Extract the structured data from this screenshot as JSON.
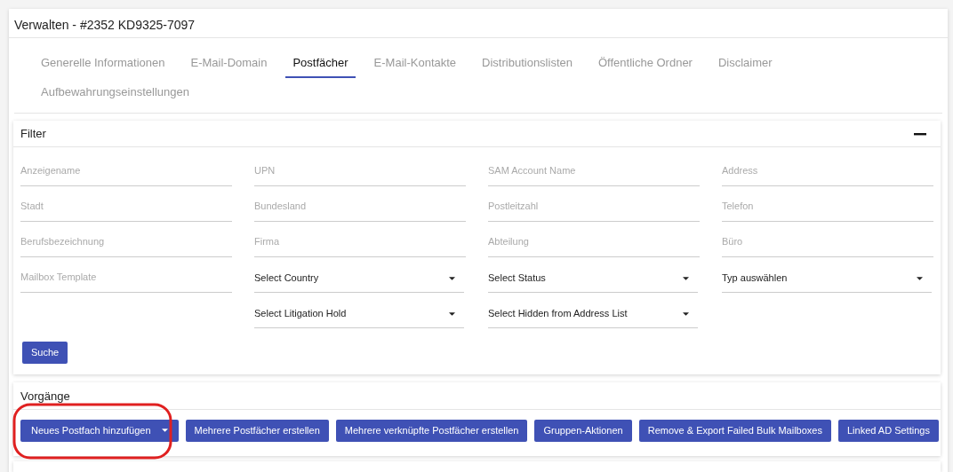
{
  "title": "Verwalten - #2352 KD9325-7097",
  "tabs": [
    {
      "label": "Generelle Informationen",
      "selected": false
    },
    {
      "label": "E-Mail-Domain",
      "selected": false
    },
    {
      "label": "Postfächer",
      "selected": true
    },
    {
      "label": "E-Mail-Kontakte",
      "selected": false
    },
    {
      "label": "Distributionslisten",
      "selected": false
    },
    {
      "label": "Öffentliche Ordner",
      "selected": false
    },
    {
      "label": "Disclaimer",
      "selected": false
    },
    {
      "label": "Aufbewahrungseinstellungen",
      "selected": false
    }
  ],
  "filter": {
    "title": "Filter",
    "expanded": true,
    "rows": [
      [
        {
          "kind": "input",
          "placeholder": "Anzeigename"
        },
        {
          "kind": "input",
          "placeholder": "UPN"
        },
        {
          "kind": "input",
          "placeholder": "SAM Account Name"
        },
        {
          "kind": "input",
          "placeholder": "Address"
        }
      ],
      [
        {
          "kind": "input",
          "placeholder": "Stadt"
        },
        {
          "kind": "input",
          "placeholder": "Bundesland"
        },
        {
          "kind": "input",
          "placeholder": "Postleitzahl"
        },
        {
          "kind": "input",
          "placeholder": "Telefon"
        }
      ],
      [
        {
          "kind": "input",
          "placeholder": "Berufsbezeichnung"
        },
        {
          "kind": "input",
          "placeholder": "Firma"
        },
        {
          "kind": "input",
          "placeholder": "Abteilung"
        },
        {
          "kind": "input",
          "placeholder": "Büro"
        }
      ],
      [
        {
          "kind": "input",
          "placeholder": "Mailbox Template"
        },
        {
          "kind": "select",
          "value": "Select Country"
        },
        {
          "kind": "select",
          "value": "Select Status"
        },
        {
          "kind": "select",
          "value": "Typ auswählen"
        }
      ],
      [
        {
          "kind": "blank"
        },
        {
          "kind": "select",
          "value": "Select Litigation Hold"
        },
        {
          "kind": "select",
          "value": "Select Hidden from Address List"
        },
        {
          "kind": "blank"
        }
      ]
    ],
    "search_button": "Suche"
  },
  "actions": {
    "title": "Vorgänge",
    "buttons": [
      {
        "label": "Neues Postfach hinzufügen",
        "kind": "dropdown",
        "highlighted": true
      },
      {
        "label": "Mehrere Postfächer erstellen",
        "kind": "plain",
        "highlighted": false
      },
      {
        "label": "Mehrere verknüpfte Postfächer erstellen",
        "kind": "plain",
        "highlighted": false
      },
      {
        "label": "Gruppen-Aktionen",
        "kind": "plain",
        "highlighted": false
      },
      {
        "label": "Remove & Export Failed Bulk Mailboxes",
        "kind": "plain",
        "highlighted": false
      },
      {
        "label": "Linked AD Settings",
        "kind": "plain",
        "highlighted": false
      }
    ]
  }
}
